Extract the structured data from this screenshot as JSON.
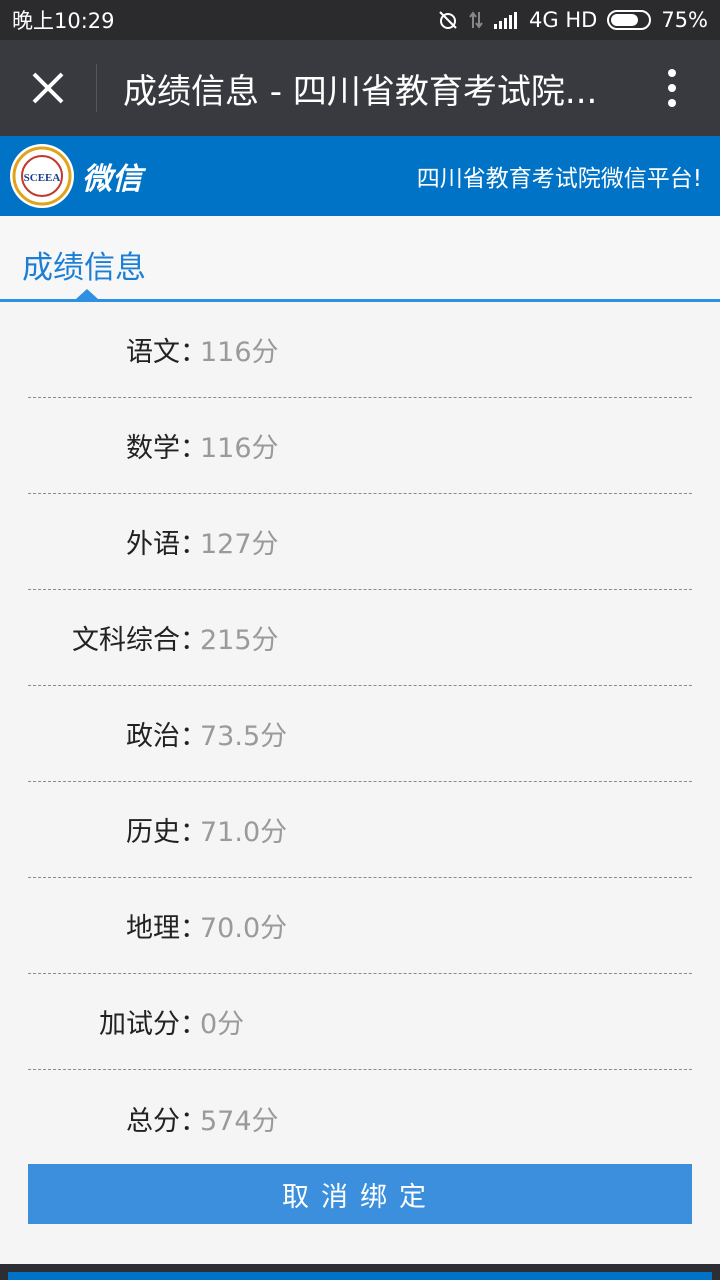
{
  "statusbar": {
    "time": "晚上10:29",
    "network": "4G HD",
    "battery_text": "75%",
    "battery_level": 0.75
  },
  "titlebar": {
    "title": "成绩信息 - 四川省教育考试院..."
  },
  "banner": {
    "weixin_label": "微信",
    "logo_text": "SCEEA",
    "slogan": "四川省教育考试院微信平台!"
  },
  "tab": {
    "label": "成绩信息"
  },
  "scores": [
    {
      "label": "语文",
      "colon": "：",
      "value": "116分"
    },
    {
      "label": "数学",
      "colon": "：",
      "value": "116分"
    },
    {
      "label": "外语",
      "colon": "：",
      "value": "127分"
    },
    {
      "label": "文科综合",
      "colon": "：",
      "value": "215分"
    },
    {
      "label": "政治",
      "colon": "：",
      "value": "73.5分"
    },
    {
      "label": "历史",
      "colon": "：",
      "value": "71.0分"
    },
    {
      "label": "地理",
      "colon": "：",
      "value": "70.0分"
    },
    {
      "label": "加试分",
      "colon": "：",
      "value": "0分"
    },
    {
      "label": "总分",
      "colon": "：",
      "value": "574分"
    }
  ],
  "actions": {
    "unbind_label": "取消绑定"
  },
  "colors": {
    "accent": "#0073c6",
    "button": "#3b8fdc",
    "titlebar": "#393a3f"
  }
}
